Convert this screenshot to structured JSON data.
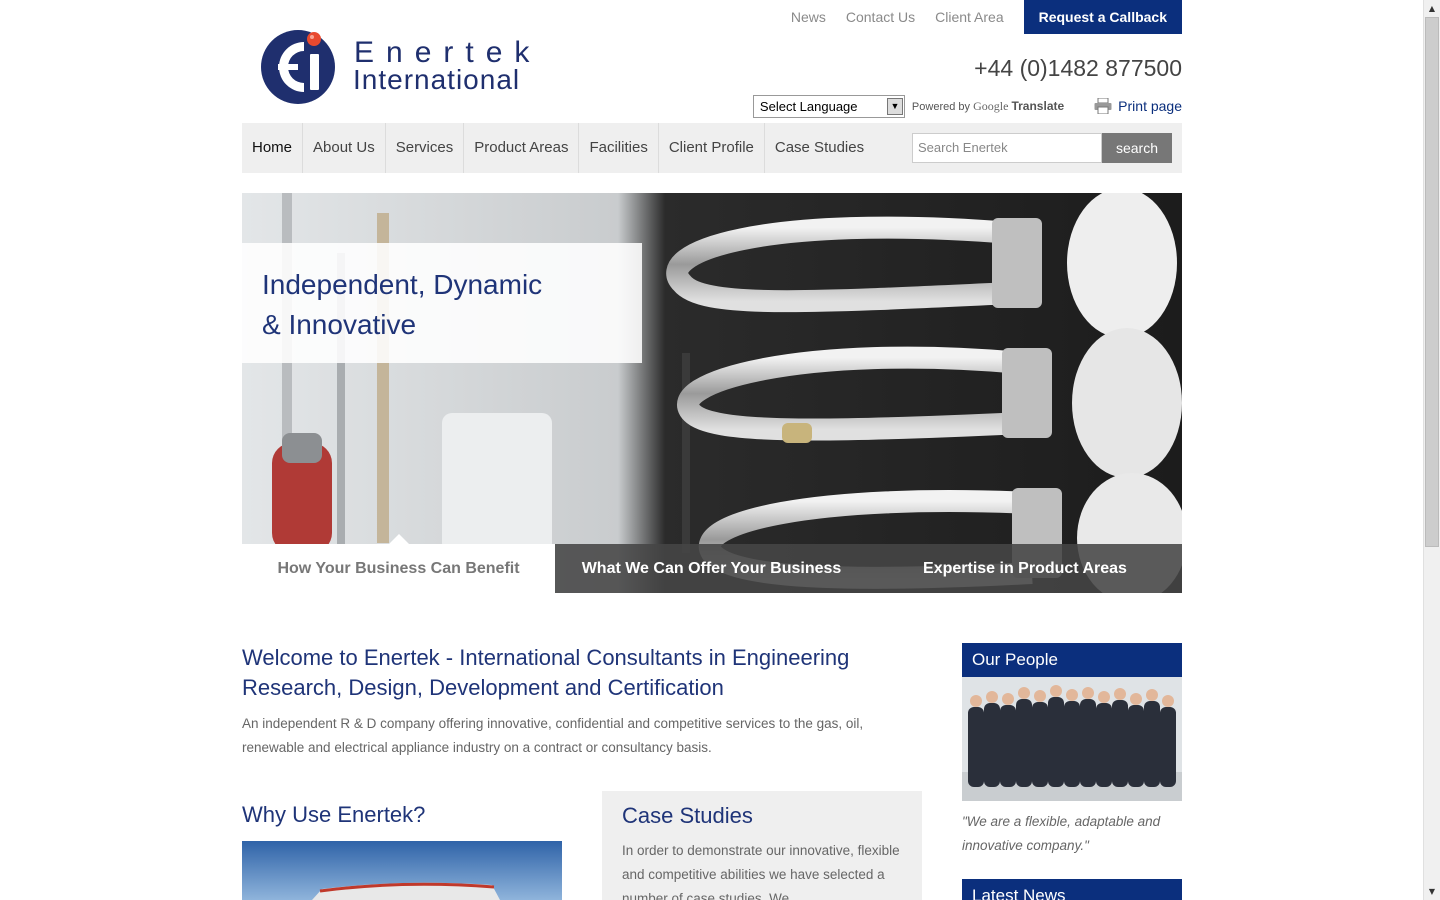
{
  "toplinks": {
    "news": "News",
    "contact": "Contact Us",
    "client_area": "Client Area",
    "callback": "Request a Callback"
  },
  "logo": {
    "line1": "Enertek",
    "line2": "International"
  },
  "phone": "+44 (0)1482 877500",
  "translate": {
    "select_label": "Select Language",
    "powered_by": "Powered by",
    "google": "Google",
    "translate": "Translate"
  },
  "print_label": "Print page",
  "nav": {
    "items": [
      "Home",
      "About Us",
      "Services",
      "Product Areas",
      "Facilities",
      "Client Profile",
      "Case Studies"
    ],
    "search_placeholder": "Search Enertek",
    "search_button": "search"
  },
  "hero": {
    "caption_line1": "Independent, Dynamic",
    "caption_line2": "& Innovative",
    "tabs": [
      "How Your Business Can Benefit",
      "What We Can Offer Your Business",
      "Expertise in Product Areas"
    ]
  },
  "welcome": {
    "title": "Welcome to Enertek - International Consultants in Engineering Research, Design, Development and Certification",
    "body": "An independent R & D company offering innovative, confidential and competitive services to the gas, oil, renewable and electrical appliance industry on a contract or consultancy basis."
  },
  "why": {
    "title": "Why Use Enertek?"
  },
  "case_studies": {
    "title": "Case Studies",
    "body": "In order to demonstrate our innovative, flexible and competitive abilities we have selected a number of case studies. We"
  },
  "sidebar": {
    "people_title": "Our People",
    "quote": "\"We are a flexible, adaptable and innovative company.\"",
    "news_title": "Latest News"
  },
  "colors": {
    "brand_blue": "#0b2f7d",
    "heading_blue": "#1f3478",
    "logo_red": "#e8492f"
  }
}
